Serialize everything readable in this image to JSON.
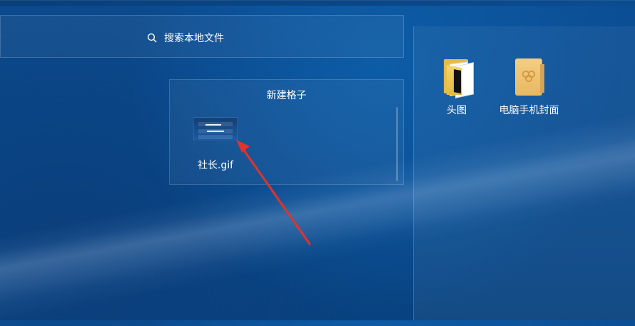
{
  "search": {
    "label": "搜索本地文件",
    "icon": "search-icon"
  },
  "grid": {
    "title": "新建格子",
    "file_name": "社长.gif"
  },
  "desktop": {
    "items": [
      {
        "label": "头图",
        "icon": "folder-icon"
      },
      {
        "label": "电脑手机封面",
        "icon": "archive-icon"
      }
    ]
  },
  "colors": {
    "desktop_blue": "#0a4b8f",
    "panel_border": "#ffffff",
    "annotation_red": "#e3322c"
  }
}
